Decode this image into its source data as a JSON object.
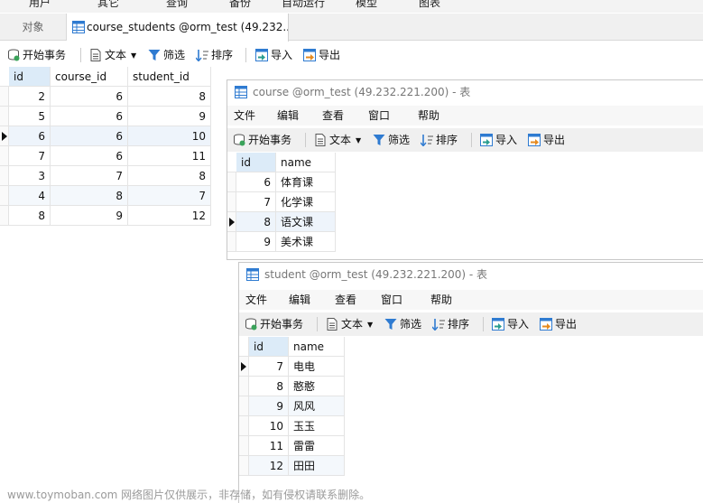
{
  "top_menu": [
    "用户",
    "其它",
    "查询",
    "备份",
    "自动运行",
    "模型",
    "图表"
  ],
  "tabs": {
    "objects": "对象",
    "active": "course_students @orm_test (49.232...."
  },
  "toolbar": {
    "begin_tx": "开始事务",
    "text": "文本",
    "filter": "筛选",
    "sort": "排序",
    "import": "导入",
    "export": "导出"
  },
  "main_table": {
    "columns": [
      "id",
      "course_id",
      "student_id"
    ],
    "rows": [
      [
        "2",
        "6",
        "8"
      ],
      [
        "5",
        "6",
        "9"
      ],
      [
        "6",
        "6",
        "10"
      ],
      [
        "7",
        "6",
        "11"
      ],
      [
        "3",
        "7",
        "8"
      ],
      [
        "4",
        "8",
        "7"
      ],
      [
        "8",
        "9",
        "12"
      ]
    ]
  },
  "course_window": {
    "title": "course @orm_test (49.232.221.200) - 表",
    "menu": [
      "文件",
      "编辑",
      "查看",
      "窗口",
      "帮助"
    ],
    "columns": [
      "id",
      "name"
    ],
    "rows": [
      [
        "6",
        "体育课"
      ],
      [
        "7",
        "化学课"
      ],
      [
        "8",
        "语文课"
      ],
      [
        "9",
        "美术课"
      ]
    ]
  },
  "student_window": {
    "title": "student @orm_test (49.232.221.200) - 表",
    "menu": [
      "文件",
      "编辑",
      "查看",
      "窗口",
      "帮助"
    ],
    "columns": [
      "id",
      "name"
    ],
    "rows": [
      [
        "7",
        "电电"
      ],
      [
        "8",
        "憨憨"
      ],
      [
        "9",
        "风风"
      ],
      [
        "10",
        "玉玉"
      ],
      [
        "11",
        "雷雷"
      ],
      [
        "12",
        "田田"
      ]
    ]
  },
  "watermark": "www.toymoban.com 网络图片仅供展示，非存储，如有侵权请联系删除。",
  "colors": {
    "header_selected": "#dcebf8",
    "grid_line": "#e4e4e4",
    "icon_blue": "#2f7bd1",
    "icon_teal": "#2a9d8f",
    "icon_orange": "#e58a1f"
  }
}
